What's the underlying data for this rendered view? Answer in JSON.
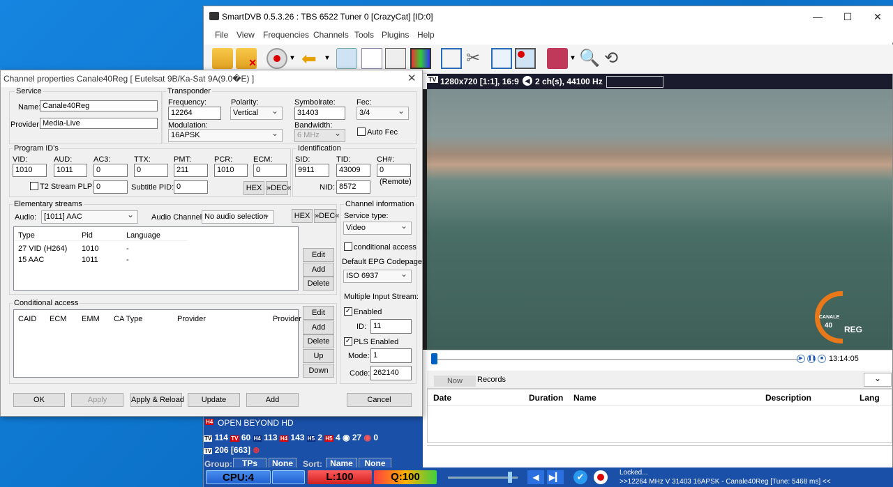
{
  "main": {
    "title": "SmartDVB 0.5.3.26 : TBS 6522 Tuner 0 [CrazyCat] [ID:0]",
    "menu": [
      "File",
      "View",
      "Frequencies",
      "Channels",
      "Tools",
      "Plugins",
      "Help"
    ],
    "video_info": "1280x720 [1:1], 16:9",
    "audio_info": "2 ch(s), 44100 Hz",
    "time": "13:14:05",
    "tabs": [
      "Now",
      "Records"
    ],
    "epg_columns": [
      "Date",
      "Duration",
      "Name",
      "Description",
      "Lang"
    ],
    "logo_text": [
      "CANALE",
      "40",
      "REG"
    ],
    "channel_line": "OPEN BEYOND HD",
    "counts": [
      "114",
      "60",
      "113",
      "143",
      "2",
      "4",
      "27",
      "0"
    ],
    "count2": "206 [663]",
    "group_label": "Group:",
    "group_btns": [
      "TPs",
      "None"
    ],
    "sort_label": "Sort:",
    "sort_btns": [
      "Name",
      "None"
    ],
    "cpu": "CPU:4",
    "level": "L:100",
    "quality": "Q:100",
    "status1": "Locked...",
    "status2": ">>12264 MHz V 31403 16APSK - Canale40Reg [Tune: 5468 ms] <<"
  },
  "dialog": {
    "title": "Channel properties Canale40Reg [ Eutelsat 9B/Ka-Sat 9A(9.0�E) ]",
    "service": {
      "group": "Service",
      "name_label": "Name:",
      "name": "Canale40Reg",
      "provider_label": "Provider:",
      "provider": "Media-Live"
    },
    "transponder": {
      "group": "Transponder",
      "freq_label": "Frequency:",
      "freq": "12264",
      "pol_label": "Polarity:",
      "pol": "Vertical",
      "sym_label": "Symbolrate:",
      "sym": "31403",
      "fec_label": "Fec:",
      "fec": "3/4",
      "mod_label": "Modulation:",
      "mod": "16APSK",
      "bw_label": "Bandwidth:",
      "bw": "6 MHz",
      "autofec": "Auto Fec"
    },
    "pids": {
      "group": "Program ID's",
      "labels": [
        "VID:",
        "AUD:",
        "AC3:",
        "TTX:",
        "PMT:",
        "PCR:",
        "ECM:"
      ],
      "values": [
        "1010",
        "1011",
        "0",
        "0",
        "211",
        "1010",
        "0"
      ],
      "t2_label": "T2 Stream PLP",
      "t2": "0",
      "sub_label": "Subtitle PID:",
      "sub": "0",
      "hex": "HEX",
      "dec": "»DEC«"
    },
    "ident": {
      "group": "Identification",
      "sid_label": "SID:",
      "sid": "9911",
      "tid_label": "TID:",
      "tid": "43009",
      "ch_label": "CH#:",
      "ch": "0",
      "nid_label": "NID:",
      "nid": "8572",
      "remote": "(Remote)"
    },
    "es": {
      "group": "Elementary streams",
      "audio_label": "Audio:",
      "audio": "[1011]  AAC",
      "ach_label": "Audio Channel:",
      "ach": "No audio selection",
      "cols": [
        "Type",
        "Pid",
        "Language"
      ],
      "rows": [
        {
          "type": "27 VID (H264)",
          "pid": "1010",
          "lang": "-"
        },
        {
          "type": "15 AAC",
          "pid": "1011",
          "lang": "-"
        }
      ],
      "buttons": [
        "Edit",
        "Add",
        "Delete"
      ]
    },
    "ca": {
      "group": "Conditional access",
      "cols": [
        "CAID",
        "ECM",
        "EMM",
        "CA Type",
        "Provider",
        "Provider"
      ],
      "buttons": [
        "Edit",
        "Add",
        "Delete",
        "Up",
        "Down"
      ]
    },
    "ci": {
      "group": "Channel information",
      "stype_label": "Service type:",
      "stype": "Video",
      "cond": "conditional access",
      "epg_label": "Default EPG Codepage:",
      "epg": "ISO 6937",
      "mis_label": "Multiple Input Stream:",
      "enabled": "Enabled",
      "id_label": "ID:",
      "id": "11",
      "pls": "PLS Enabled",
      "mode_label": "Mode:",
      "mode": "1",
      "code_label": "Code:",
      "code": "262140"
    },
    "bottom": [
      "OK",
      "Apply",
      "Apply & Reload",
      "Update",
      "Add",
      "Cancel"
    ]
  }
}
